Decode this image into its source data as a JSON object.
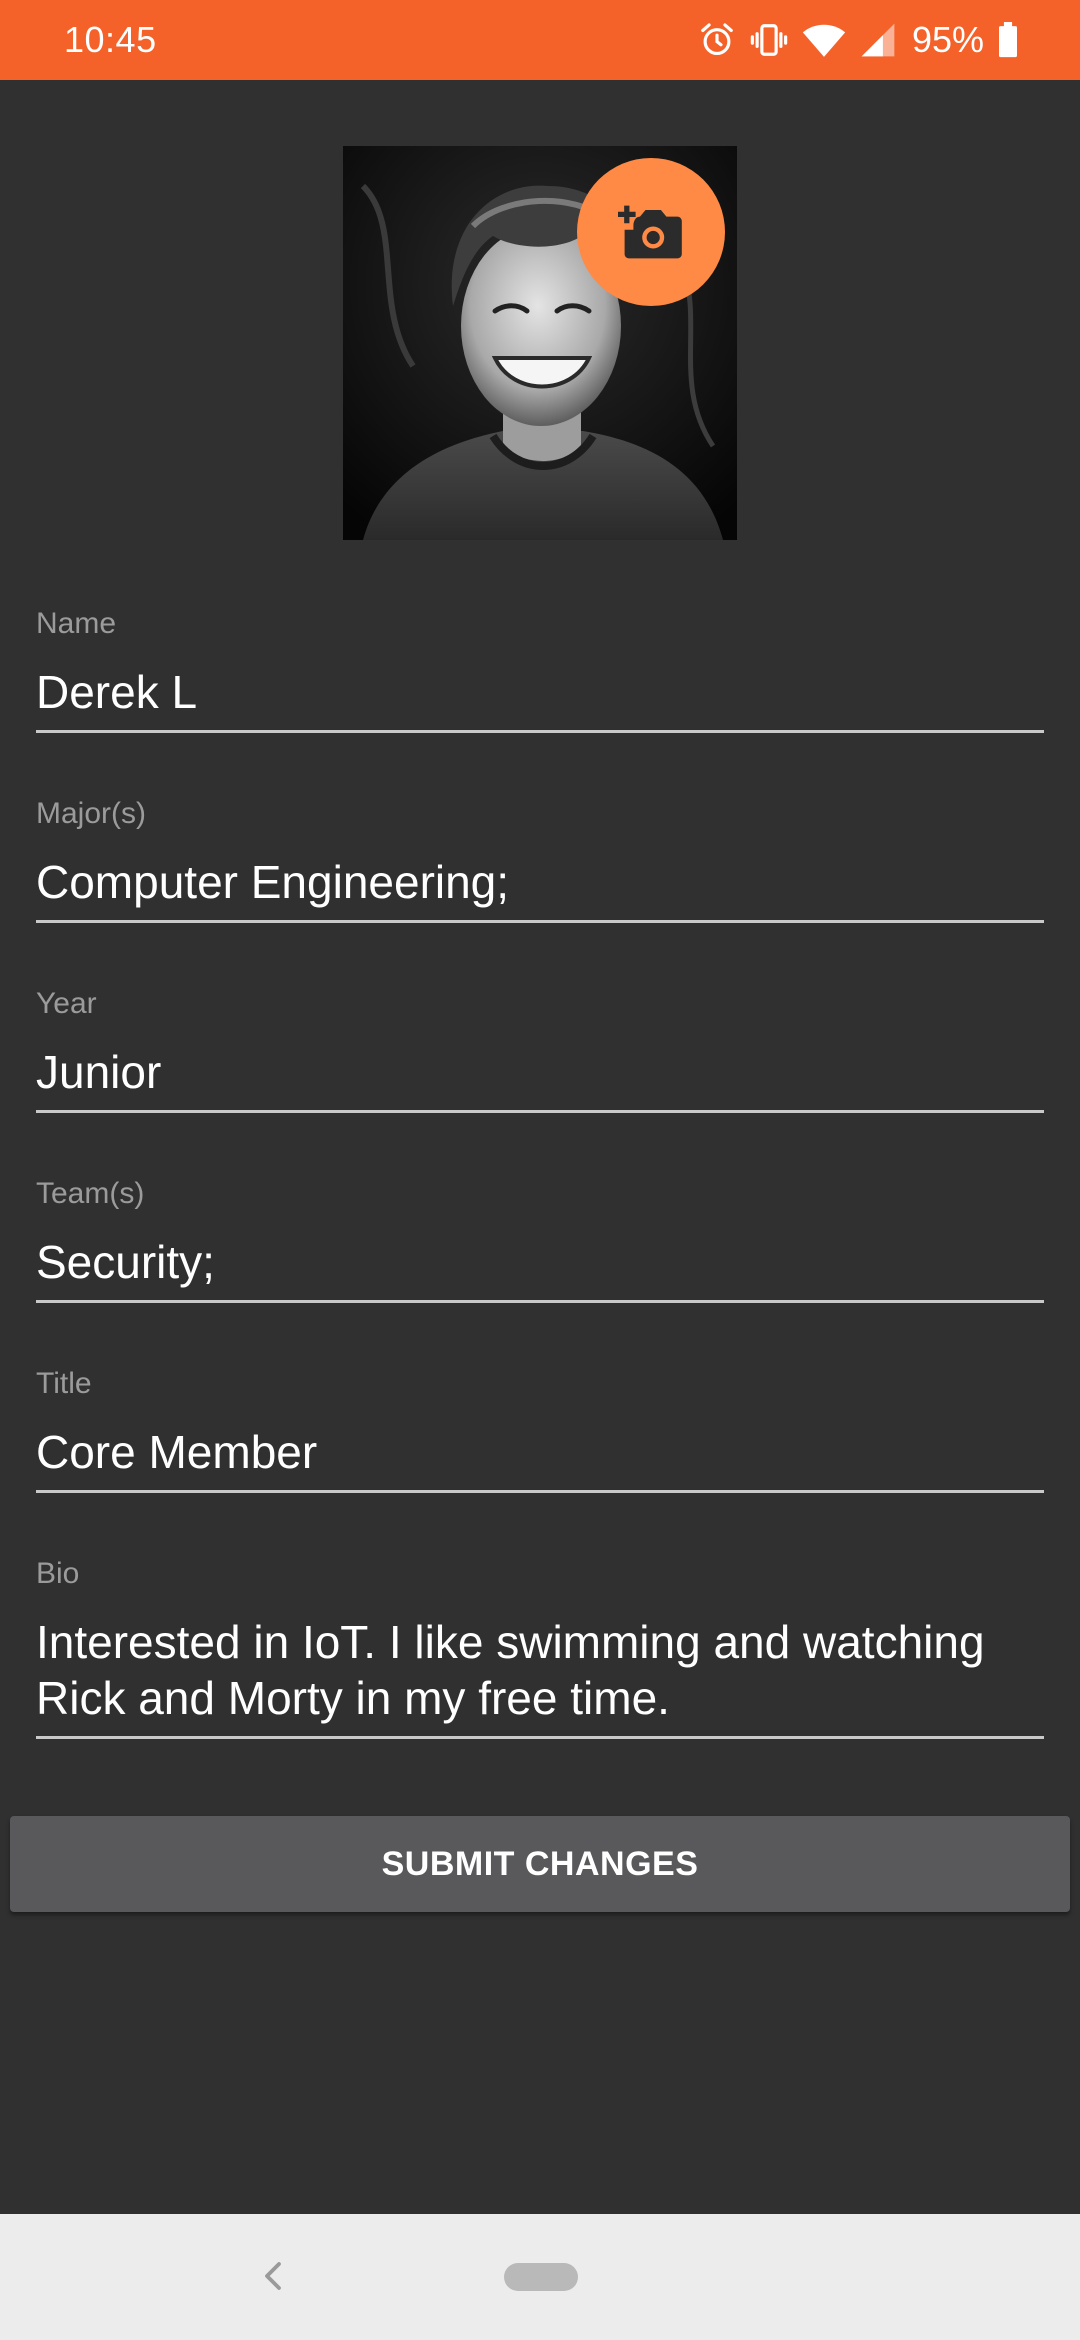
{
  "status_bar": {
    "time": "10:45",
    "battery_percent": "95%",
    "icons": [
      "alarm-icon",
      "vibrate-icon",
      "wifi-icon",
      "signal-icon",
      "battery-icon"
    ],
    "background_color": "#F4622A"
  },
  "profile": {
    "photo_icon": "person-photo",
    "change_photo_icon": "add-a-photo-icon",
    "accent_color": "#FF8A45"
  },
  "form": {
    "name": {
      "label": "Name",
      "value": "Derek L"
    },
    "majors": {
      "label": "Major(s)",
      "value": "Computer Engineering;"
    },
    "year": {
      "label": "Year",
      "value": "Junior"
    },
    "teams": {
      "label": "Team(s)",
      "value": "Security;"
    },
    "title": {
      "label": "Title",
      "value": "Core Member"
    },
    "bio": {
      "label": "Bio",
      "value": "Interested in IoT. I like swimming and watching Rick and Morty in my free time."
    }
  },
  "actions": {
    "submit_label": "SUBMIT CHANGES"
  },
  "nav_bar": {
    "back_icon": "chevron-left-icon",
    "home_icon": "home-pill-icon"
  }
}
